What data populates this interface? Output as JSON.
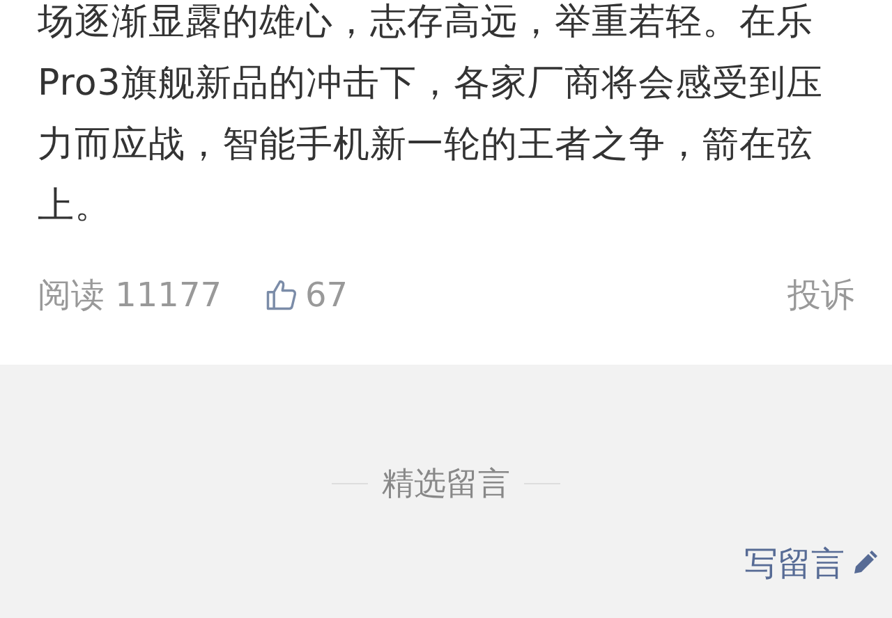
{
  "article": {
    "paragraph": "场逐渐显露的雄心，志存高远，举重若轻。在乐Pro3旗舰新品的冲击下，各家厂商将会感受到压力而应战，智能手机新一轮的王者之争，箭在弦上。"
  },
  "stats": {
    "reads_label": "阅读",
    "reads": "11177",
    "likes": "67",
    "liked": false,
    "report": "投诉"
  },
  "comments": {
    "title": "精选留言",
    "write_button": "写留言"
  }
}
